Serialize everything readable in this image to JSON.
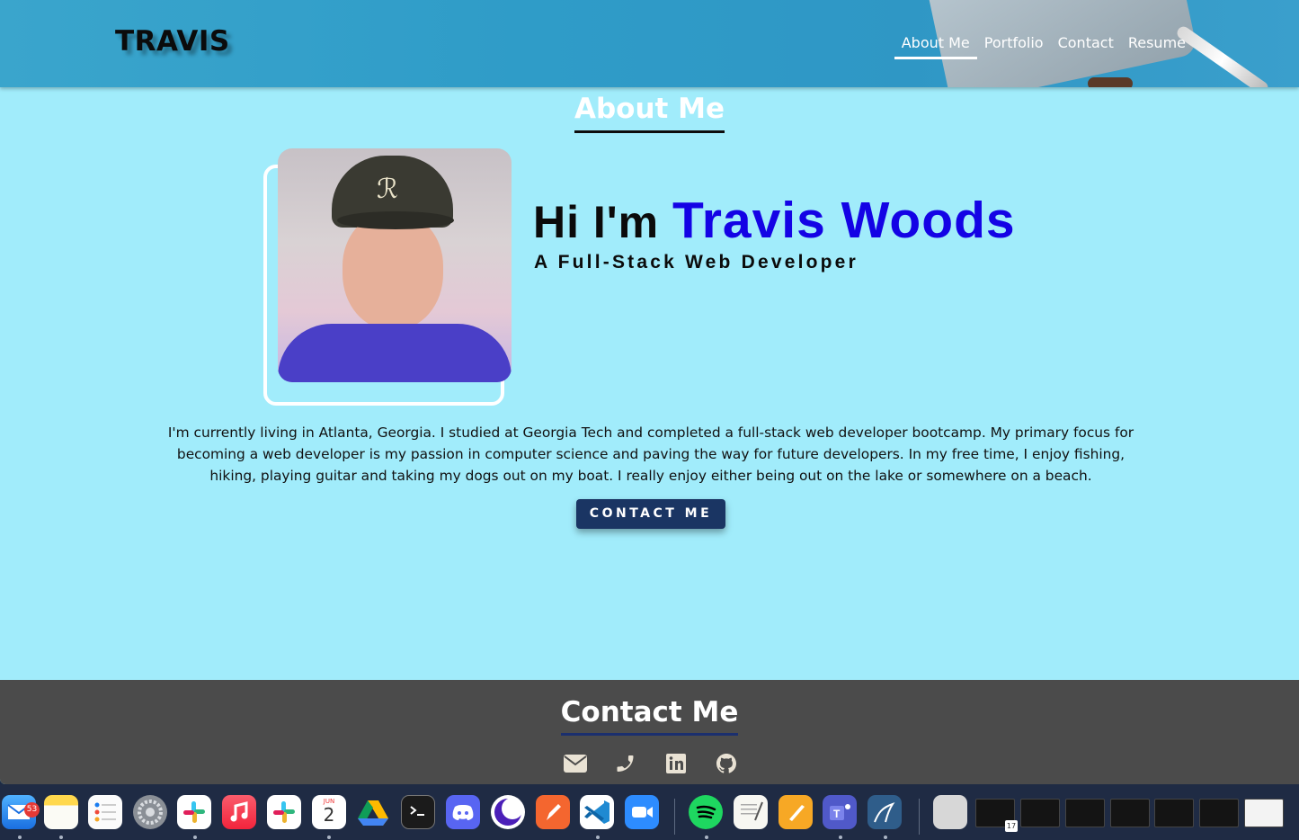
{
  "header": {
    "logo": "TRAVIS",
    "nav": [
      {
        "label": "About Me",
        "active": true
      },
      {
        "label": "Portfolio",
        "active": false
      },
      {
        "label": "Contact",
        "active": false
      },
      {
        "label": "Resume",
        "active": false
      }
    ]
  },
  "about": {
    "section_title": "About Me",
    "greeting": "Hi I'm ",
    "name": "Travis Woods",
    "subtitle": "A Full-Stack Web Developer",
    "bio": "I'm currently living in Atlanta, Georgia. I studied at Georgia Tech and completed a full-stack web developer bootcamp. My primary focus for becoming a web developer is my passion in computer science and paving the way for future developers. In my free time, I enjoy fishing, hiking, playing guitar and taking my dogs out on my boat. I really enjoy either being out on the lake or somewhere on a beach.",
    "contact_button": "CONTACT ME",
    "name_color": "#1403e5"
  },
  "footer": {
    "title": "Contact Me",
    "icons": [
      "envelope-icon",
      "phone-icon",
      "linkedin-icon",
      "github-icon"
    ]
  },
  "dock": {
    "mail_badge": "53",
    "calendar_month": "JUN",
    "calendar_day": "2",
    "thumb_calendar_day": "17"
  },
  "colors": {
    "page_background": "#a1ecfb",
    "header": "#2f9cc8",
    "footer": "#4b4b4b",
    "button": "#1a3563"
  }
}
